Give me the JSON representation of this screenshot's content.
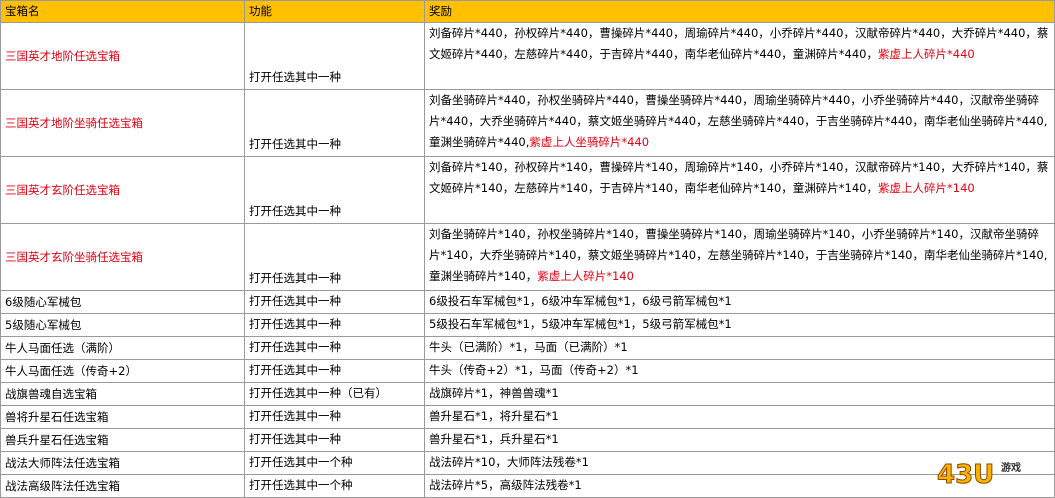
{
  "headers": {
    "name": "宝箱名",
    "func": "功能",
    "reward": "奖励"
  },
  "rows": [
    {
      "name": "三国英才地阶任选宝箱",
      "name_red": true,
      "func": "打开任选其中一种",
      "reward": "刘备碎片*440，孙权碎片*440，曹操碎片*440，周瑜碎片*440，小乔碎片*440，汉献帝碎片*440，大乔碎片*440，蔡文姬碎片*440，左慈碎片*440，于吉碎片*440，南华老仙碎片*440，童渊碎片*440，",
      "reward_red": "紫虚上人碎片*440"
    },
    {
      "name": "三国英才地阶坐骑任选宝箱",
      "name_red": true,
      "func": "打开任选其中一种",
      "reward": "刘备坐骑碎片*440，孙权坐骑碎片*440，曹操坐骑碎片*440，周瑜坐骑碎片*440，小乔坐骑碎片*440，汉献帝坐骑碎片*440，大乔坐骑碎片*440，蔡文姬坐骑碎片*440，左慈坐骑碎片*440，于吉坐骑碎片*440，南华老仙坐骑碎片*440,童渊坐骑碎片*440,",
      "reward_red": "紫虚上人坐骑碎片*440"
    },
    {
      "name": "三国英才玄阶任选宝箱",
      "name_red": true,
      "func": "打开任选其中一种",
      "reward": "刘备碎片*140，孙权碎片*140，曹操碎片*140，周瑜碎片*140，小乔碎片*140，汉献帝碎片*140，大乔碎片*140，蔡文姬碎片*140，左慈碎片*140，于吉碎片*140，南华老仙碎片*140，童渊碎片*140，",
      "reward_red": "紫虚上人碎片*140"
    },
    {
      "name": "三国英才玄阶坐骑任选宝箱",
      "name_red": true,
      "func": "打开任选其中一种",
      "reward": "刘备坐骑碎片*140，孙权坐骑碎片*140，曹操坐骑碎片*140，周瑜坐骑碎片*140，小乔坐骑碎片*140，汉献帝坐骑碎片*140，大乔坐骑碎片*140，蔡文姬坐骑碎片*140，左慈坐骑碎片*140，于吉坐骑碎片*140，南华老仙坐骑碎片*140,童渊坐骑碎片*140，",
      "reward_red": "紫虚上人碎片*140"
    },
    {
      "name": "6级随心军械包",
      "name_red": false,
      "func": "打开任选其中一种",
      "reward": "6级投石车军械包*1，6级冲车军械包*1，6级弓箭军械包*1",
      "reward_red": ""
    },
    {
      "name": "5级随心军械包",
      "name_red": false,
      "func": "打开任选其中一种",
      "reward": "5级投石车军械包*1，5级冲车军械包*1，5级弓箭军械包*1",
      "reward_red": ""
    },
    {
      "name": "牛人马面任选（满阶）",
      "name_red": false,
      "func": "打开任选其中一种",
      "reward": "牛头（已满阶）*1，马面（已满阶）*1",
      "reward_red": ""
    },
    {
      "name": "牛人马面任选（传奇+2）",
      "name_red": false,
      "func": "打开任选其中一种",
      "reward": "牛头（传奇+2）*1，马面（传奇+2）*1",
      "reward_red": ""
    },
    {
      "name": "战旗兽魂自选宝箱",
      "name_red": false,
      "func": "打开任选其中一种（已有）",
      "reward": "战旗碎片*1，神兽兽魂*1",
      "reward_red": ""
    },
    {
      "name": "兽将升星石任选宝箱",
      "name_red": false,
      "func": "打开任选其中一种",
      "reward": "兽升星石*1，将升星石*1",
      "reward_red": ""
    },
    {
      "name": "兽兵升星石任选宝箱",
      "name_red": false,
      "func": "打开任选其中一种",
      "reward": "兽升星石*1，兵升星石*1",
      "reward_red": ""
    },
    {
      "name": "战法大师阵法任选宝箱",
      "name_red": false,
      "func": "打开任选其中一个种",
      "reward": "战法碎片*10，大师阵法残卷*1",
      "reward_red": ""
    },
    {
      "name": "战法高级阵法任选宝箱",
      "name_red": false,
      "func": "打开任选其中一个种",
      "reward": "战法碎片*5，高级阵法残卷*1",
      "reward_red": ""
    }
  ],
  "watermark": {
    "text": "43U游戏"
  },
  "colors": {
    "header_bg": "#ffc000",
    "highlight_red": "#e60012",
    "border": "#9a9a9a"
  }
}
